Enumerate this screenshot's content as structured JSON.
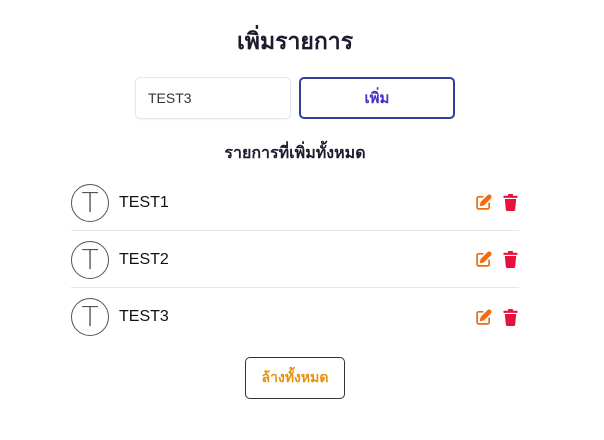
{
  "header": {
    "title": "เพิ่มรายการ"
  },
  "form": {
    "input_value": "TEST3",
    "add_label": "เพิ่ม"
  },
  "list": {
    "heading": "รายการที่เพิ่มทั้งหมด",
    "items": [
      {
        "avatar_letter": "T",
        "label": "TEST1"
      },
      {
        "avatar_letter": "T",
        "label": "TEST2"
      },
      {
        "avatar_letter": "T",
        "label": "TEST3"
      }
    ]
  },
  "footer": {
    "clear_label": "ล้างทั้งหมด"
  },
  "colors": {
    "edit_icon": "#f26b0f",
    "delete_icon": "#e8103d",
    "add_button_border": "#2f3f9c",
    "add_button_text": "#4a2fc2",
    "clear_text": "#e8920c"
  },
  "icons": {
    "edit": "edit-icon",
    "delete": "trash-icon"
  }
}
